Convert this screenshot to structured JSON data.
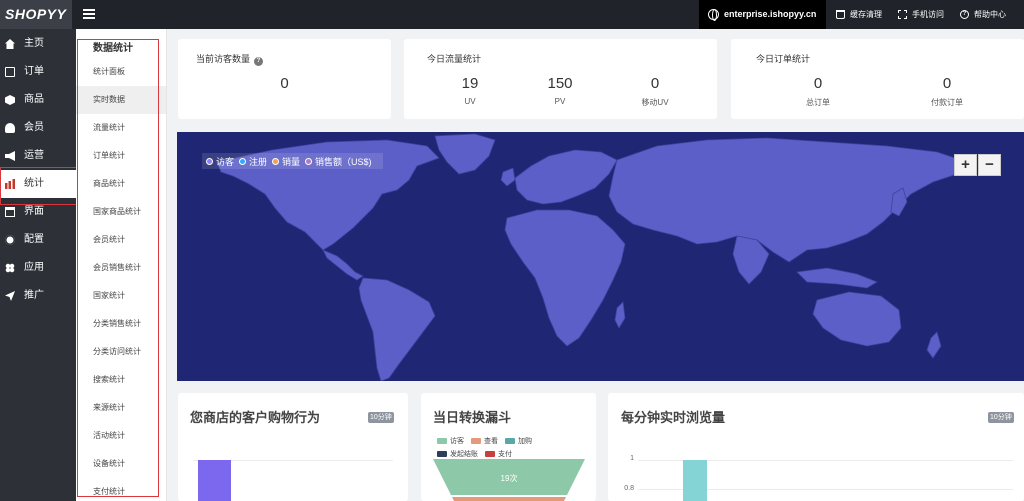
{
  "app": {
    "logo": "SHOPYY",
    "domain": "enterprise.ishopyy.cn"
  },
  "topbar": {
    "actions": [
      {
        "label": "缓存清理",
        "icon": "trash-icon"
      },
      {
        "label": "手机访问",
        "icon": "scan-icon"
      },
      {
        "label": "帮助中心",
        "icon": "help-icon"
      }
    ]
  },
  "nav": {
    "items": [
      {
        "label": "主页",
        "icon": "home-icon"
      },
      {
        "label": "订单",
        "icon": "order-icon"
      },
      {
        "label": "商品",
        "icon": "box-icon"
      },
      {
        "label": "会员",
        "icon": "users-icon"
      },
      {
        "label": "运营",
        "icon": "megaphone-icon"
      },
      {
        "label": "统计",
        "icon": "bar-chart-icon"
      },
      {
        "label": "界面",
        "icon": "window-icon"
      },
      {
        "label": "配置",
        "icon": "gear-icon"
      },
      {
        "label": "应用",
        "icon": "apps-icon"
      },
      {
        "label": "推广",
        "icon": "send-icon"
      }
    ],
    "active_index": 5
  },
  "subnav": {
    "title": "数据统计",
    "items": [
      "统计面板",
      "实时数据",
      "流量统计",
      "订单统计",
      "商品统计",
      "国家商品统计",
      "会员统计",
      "会员销售统计",
      "国家统计",
      "分类销售统计",
      "分类访问统计",
      "搜索统计",
      "来源统计",
      "活动统计",
      "设备统计",
      "支付统计"
    ],
    "active_index": 1
  },
  "cards": {
    "visitors": {
      "title": "当前访客数量",
      "help_icon": "?",
      "value": "0"
    },
    "traffic": {
      "title": "今日流量统计",
      "stats": [
        {
          "value": "19",
          "label": "UV"
        },
        {
          "value": "150",
          "label": "PV"
        },
        {
          "value": "0",
          "label": "移动UV"
        }
      ]
    },
    "orders": {
      "title": "今日订单统计",
      "stats": [
        {
          "value": "0",
          "label": "总订单"
        },
        {
          "value": "0",
          "label": "付款订单"
        }
      ]
    }
  },
  "map": {
    "legend": [
      {
        "label": "访客",
        "color": "#8e80f0"
      },
      {
        "label": "注册",
        "color": "#2fa8ff"
      },
      {
        "label": "销量",
        "color": "#f0a050"
      },
      {
        "label": "销售额（US$)",
        "color": "#b07ac0"
      }
    ],
    "zoom_in": "+",
    "zoom_out": "−",
    "colors": {
      "ocean": "#1f2673",
      "land": "#5b5fc7",
      "border": "#3e43a0"
    }
  },
  "bottom": {
    "behavior": {
      "title": "您商店的客户购物行为",
      "tag": "10分钟",
      "bar_value": 1,
      "bar_color": "#7b68ee"
    },
    "funnel": {
      "title": "当日转换漏斗",
      "legend": [
        {
          "label": "访客",
          "color": "#8dc8a8"
        },
        {
          "label": "查看",
          "color": "#e29a7a"
        },
        {
          "label": "加购",
          "color": "#5aa7a7"
        },
        {
          "label": "发起结账",
          "color": "#2f3e57"
        },
        {
          "label": "支付",
          "color": "#c93f3f"
        }
      ],
      "stage_label": "19次"
    },
    "realtime": {
      "title": "每分钟实时浏览量",
      "tag": "10分钟",
      "y_ticks": [
        "1",
        "0.8"
      ],
      "bar_value": 1,
      "bar_color": "#84d4d6"
    }
  }
}
